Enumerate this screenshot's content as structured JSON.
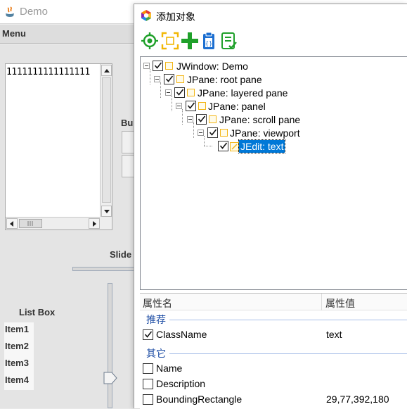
{
  "demo_window": {
    "title": "Demo",
    "menu_label": "Menu",
    "text_area_content": "1111111111111111",
    "button_label_partial": "Bu",
    "slider_label_partial": "Slide",
    "list_box_label": "List Box",
    "list_items": [
      "Item1",
      "Item2",
      "Item3",
      "Item4"
    ]
  },
  "dialog": {
    "title": "添加对象",
    "toolbar": {
      "icons": [
        "target-icon",
        "capture-region-icon",
        "add-icon",
        "clipboard-icon",
        "checklist-icon"
      ]
    },
    "tree": [
      {
        "label": "JWindow: Demo",
        "checked": true,
        "expanded": true,
        "selected": false
      },
      {
        "label": "JPane: root pane",
        "checked": true,
        "expanded": true,
        "selected": false
      },
      {
        "label": "JPane: layered pane",
        "checked": true,
        "expanded": true,
        "selected": false
      },
      {
        "label": "JPane: panel",
        "checked": true,
        "expanded": true,
        "selected": false
      },
      {
        "label": "JPane: scroll pane",
        "checked": true,
        "expanded": true,
        "selected": false
      },
      {
        "label": "JPane: viewport",
        "checked": true,
        "expanded": true,
        "selected": false
      },
      {
        "label": "JEdit: text",
        "checked": true,
        "expanded": false,
        "selected": true
      }
    ],
    "properties": {
      "col_name": "属性名",
      "col_value": "属性值",
      "group_recommended": "推荐",
      "group_other": "其它",
      "recommended": [
        {
          "name": "ClassName",
          "value": "text",
          "checked": true
        }
      ],
      "other": [
        {
          "name": "Name",
          "value": "",
          "checked": false
        },
        {
          "name": "Description",
          "value": "",
          "checked": false
        },
        {
          "name": "BoundingRectangle",
          "value": "29,77,392,180",
          "checked": false
        }
      ]
    },
    "colors": {
      "selection": "#0078d7",
      "group_title": "#1f4ea5",
      "node_icon_border": "#f3b515",
      "add_icon": "#1fa02a",
      "target_icon": "#1fa02a",
      "clipboard_icon": "#1c6fd1"
    }
  }
}
